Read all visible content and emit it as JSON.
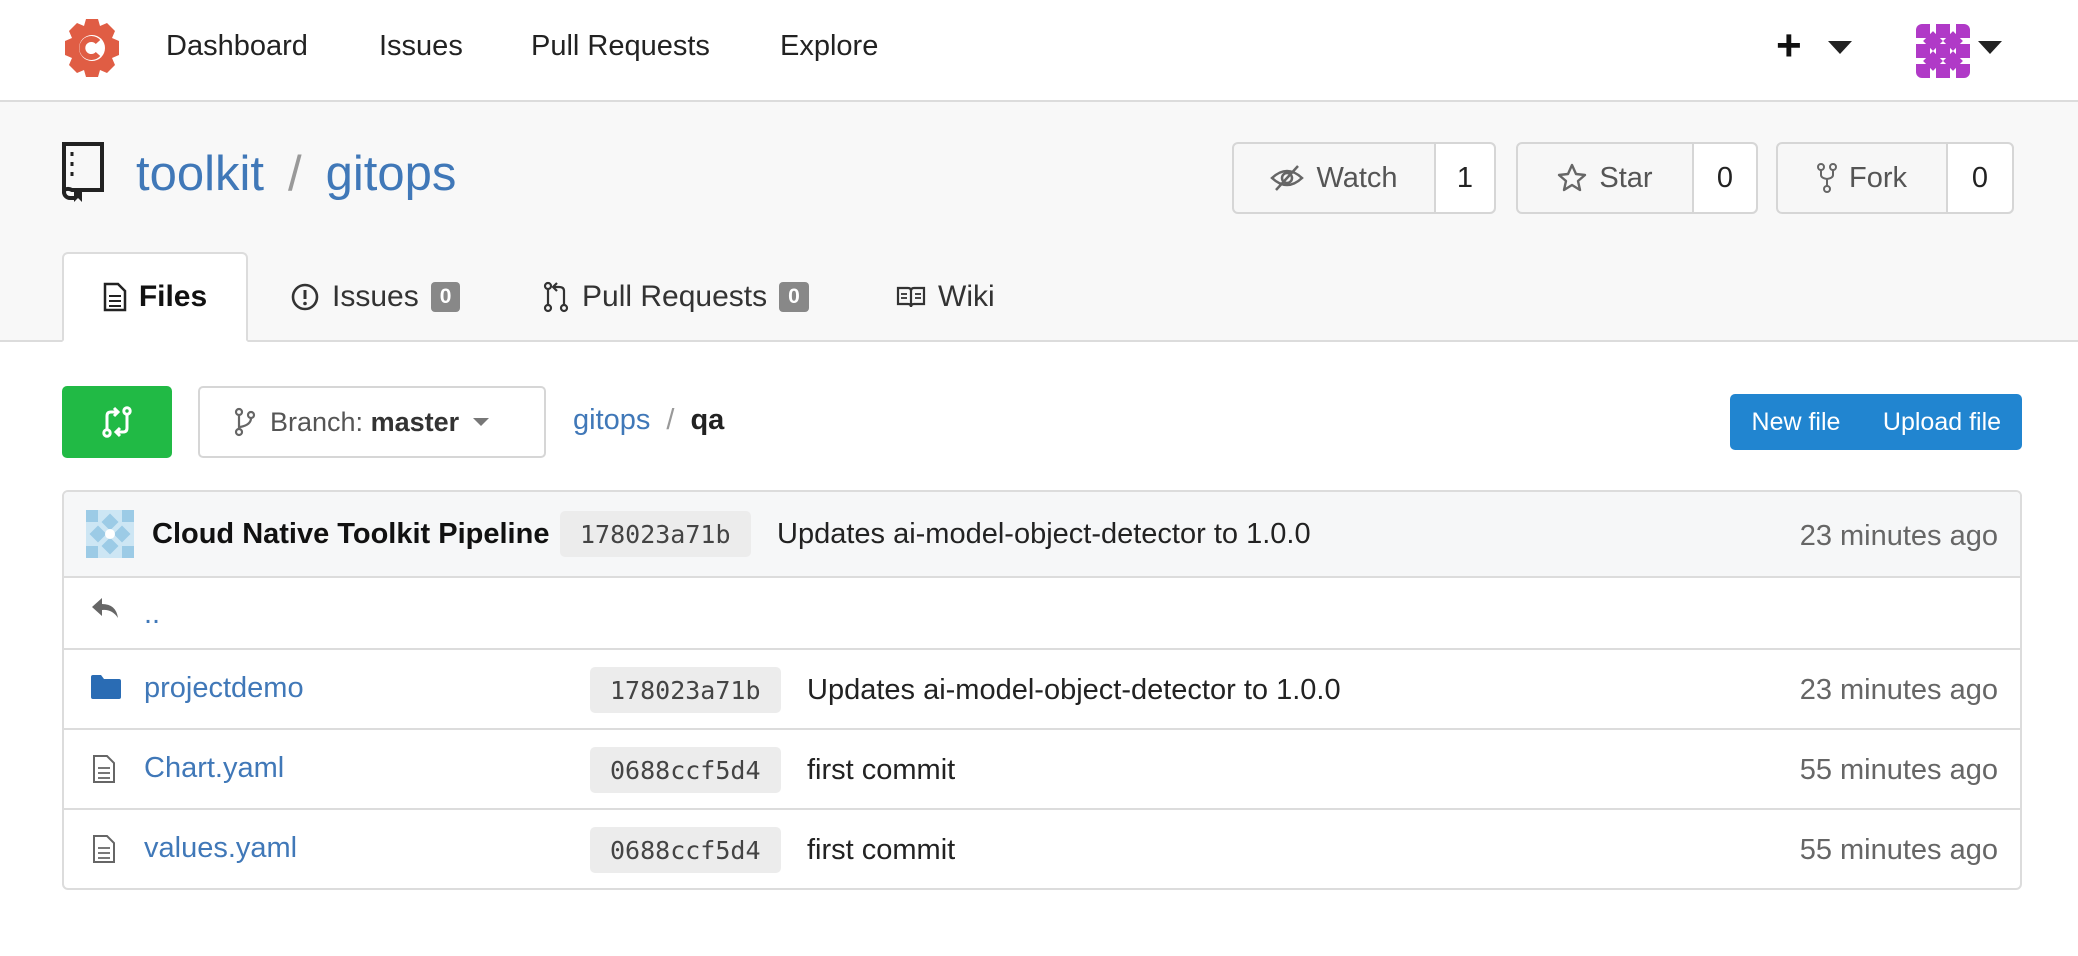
{
  "nav": {
    "links": [
      "Dashboard",
      "Issues",
      "Pull Requests",
      "Explore"
    ],
    "plus": "+",
    "brand_color": "#e05d44"
  },
  "repo": {
    "owner": "toolkit",
    "separator": "/",
    "name": "gitops",
    "watch": {
      "label": "Watch",
      "count": "1"
    },
    "star": {
      "label": "Star",
      "count": "0"
    },
    "fork": {
      "label": "Fork",
      "count": "0"
    }
  },
  "tabs": [
    {
      "label": "Files",
      "icon": "file-text-icon",
      "active": true
    },
    {
      "label": "Issues",
      "count": "0",
      "icon": "issue-opened-icon"
    },
    {
      "label": "Pull Requests",
      "count": "0",
      "icon": "git-pull-request-icon"
    },
    {
      "label": "Wiki",
      "icon": "book-icon"
    }
  ],
  "toolbar": {
    "branch_prefix": "Branch:",
    "branch": "master",
    "path_root": "gitops",
    "path_sep": "/",
    "path_current": "qa",
    "new_file": "New file",
    "upload_file": "Upload file"
  },
  "latest_commit": {
    "author": "Cloud Native Toolkit Pipeline",
    "sha": "178023a71b",
    "message": "Updates ai-model-object-detector to 1.0.0",
    "age": "23 minutes ago"
  },
  "parent_link": "..",
  "files": [
    {
      "name": "projectdemo",
      "type": "folder",
      "sha": "178023a71b",
      "message": "Updates ai-model-object-detector to 1.0.0",
      "age": "23 minutes ago"
    },
    {
      "name": "Chart.yaml",
      "type": "file",
      "sha": "0688ccf5d4",
      "message": "first commit",
      "age": "55 minutes ago"
    },
    {
      "name": "values.yaml",
      "type": "file",
      "sha": "0688ccf5d4",
      "message": "first commit",
      "age": "55 minutes ago"
    }
  ],
  "colors": {
    "link": "#4078b8",
    "green": "#21ba45",
    "blue": "#2185d0"
  }
}
